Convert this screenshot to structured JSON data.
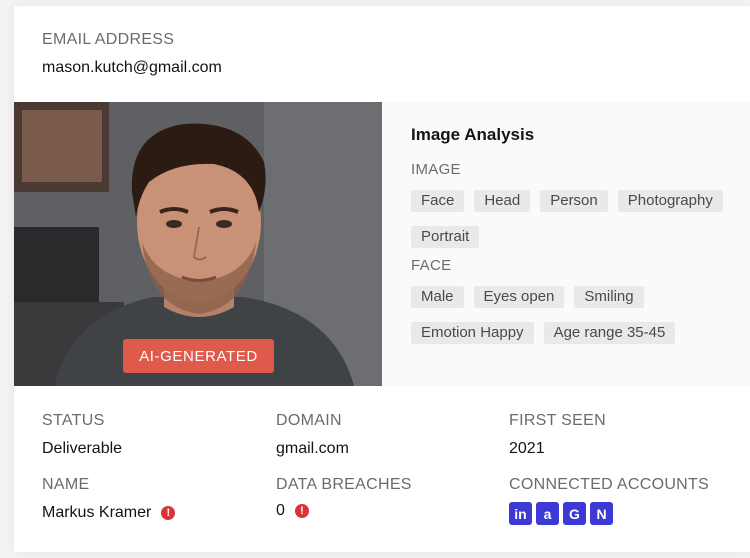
{
  "email": {
    "label": "EMAIL ADDRESS",
    "value": "mason.kutch@gmail.com"
  },
  "photo": {
    "badge": "AI-GENERATED"
  },
  "analysis": {
    "title": "Image Analysis",
    "image_label": "IMAGE",
    "image_tags": [
      "Face",
      "Head",
      "Person",
      "Photography",
      "Portrait"
    ],
    "face_label": "FACE",
    "face_tags": [
      "Male",
      "Eyes open",
      "Smiling",
      "Emotion Happy",
      "Age range 35-45"
    ]
  },
  "details": {
    "status": {
      "label": "STATUS",
      "value": "Deliverable"
    },
    "domain": {
      "label": "DOMAIN",
      "value": "gmail.com"
    },
    "first_seen": {
      "label": "FIRST SEEN",
      "value": "2021"
    },
    "name": {
      "label": "NAME",
      "value": "Markus Kramer",
      "alert": "!"
    },
    "breaches": {
      "label": "DATA BREACHES",
      "value": "0",
      "alert": "!"
    },
    "connected": {
      "label": "CONNECTED ACCOUNTS",
      "accounts": [
        {
          "icon": "linkedin-icon",
          "glyph": "in"
        },
        {
          "icon": "amazon-icon",
          "glyph": "a"
        },
        {
          "icon": "google-icon",
          "glyph": "G"
        },
        {
          "icon": "notion-icon",
          "glyph": "N"
        }
      ]
    }
  },
  "colors": {
    "accent": "#3d39d4",
    "badge": "#e05a4b",
    "alert": "#d9343a"
  }
}
